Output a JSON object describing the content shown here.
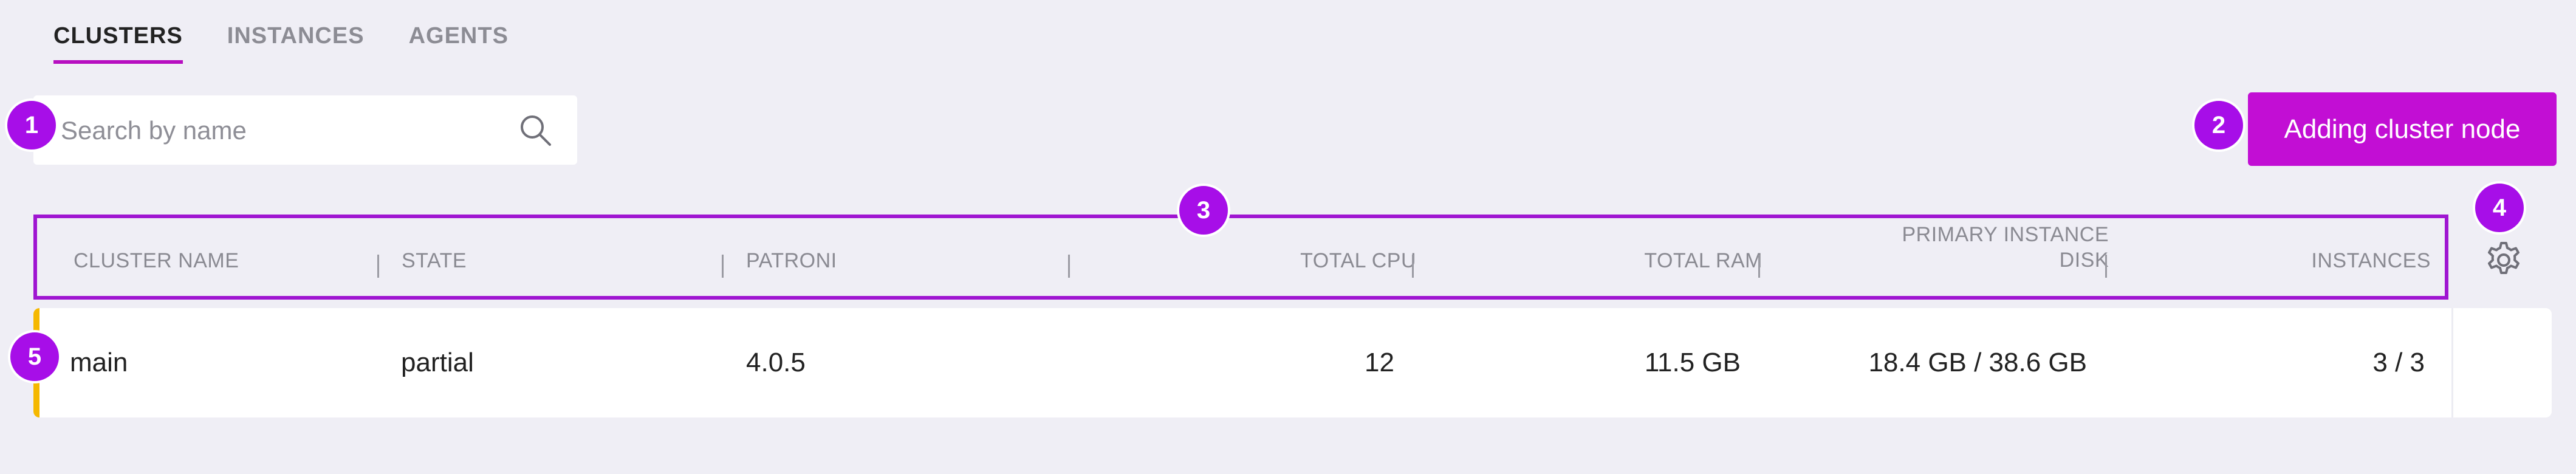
{
  "tabs": [
    {
      "label": "CLUSTERS",
      "active": true
    },
    {
      "label": "INSTANCES",
      "active": false
    },
    {
      "label": "AGENTS",
      "active": false
    }
  ],
  "search": {
    "placeholder": "Search by name",
    "value": "",
    "icon": "search-icon"
  },
  "actions": {
    "add_label": "Adding cluster node"
  },
  "table": {
    "columns": [
      {
        "label": "CLUSTER NAME"
      },
      {
        "label": "STATE"
      },
      {
        "label": "PATRONI"
      },
      {
        "label": ""
      },
      {
        "label": "TOTAL CPU"
      },
      {
        "label": "TOTAL RAM"
      },
      {
        "label_line1": "PRIMARY INSTANCE",
        "label_line2": "DISK"
      },
      {
        "label": "INSTANCES"
      }
    ],
    "settings_icon": "gear-icon",
    "rows": [
      {
        "name": "main",
        "state": "partial",
        "patroni": "4.0.5",
        "extra": "",
        "total_cpu": "12",
        "total_ram": "11.5 GB",
        "primary_disk": "18.4 GB / 38.6 GB",
        "instances": "3 / 3",
        "status_color": "#f5b800"
      }
    ]
  },
  "annotations": [
    "1",
    "2",
    "3",
    "4",
    "5"
  ],
  "colors": {
    "accent": "#c20ed4",
    "annotation": "#a70ee8",
    "background": "#efeef5"
  }
}
